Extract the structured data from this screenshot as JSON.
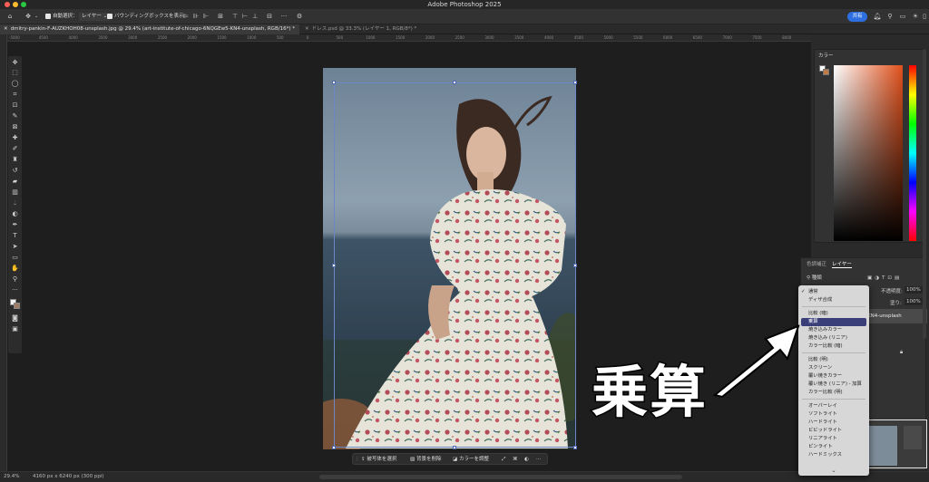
{
  "window": {
    "title": "Adobe Photoshop 2025"
  },
  "options_bar": {
    "auto_select_label": "自動選択：",
    "auto_select_value": "レイヤー",
    "bounding_box_label": "バウンディングボックスを表示",
    "share_label": "共有"
  },
  "tabs": [
    {
      "label": "dmitry-pankin-F-AUZKHOH08-unsplash.jpg @ 29.4% (art-institute-of-chicago-6NQGEw5-KN4-unsplash, RGB/16*) *",
      "active": true
    },
    {
      "label": "ドレス.psd @ 33.3% (レイヤー 1, RGB/8*) *",
      "active": false
    }
  ],
  "ruler": {
    "ticks": [
      "-5000",
      "4500",
      "4000",
      "3500",
      "3000",
      "2500",
      "2000",
      "1500",
      "1000",
      "500",
      "0",
      "500",
      "1000",
      "1500",
      "2000",
      "2500",
      "3000",
      "3500",
      "4000",
      "4500",
      "5000",
      "5500",
      "6000",
      "6500",
      "7000",
      "7500",
      "8000",
      "8500",
      "9000",
      "9500",
      "10000"
    ]
  },
  "toolbar": {
    "more_label": "···"
  },
  "context_bar": {
    "select_subject": "被写体を選択",
    "remove_bg": "背景を削除",
    "color_adjust": "カラーを調整",
    "more": "···"
  },
  "status": {
    "zoom": "29.4%",
    "doc_info": "4160 px x 6240 px (300 ppi)"
  },
  "color_panel": {
    "title": "カラー"
  },
  "layers_panel": {
    "tab_adjust": "色調補正",
    "tab_layers": "レイヤー",
    "filter_label": "種類",
    "opacity_label": "不透明度:",
    "opacity_value": "100%",
    "fill_label": "塗り:",
    "fill_value": "100%",
    "layer_name": "KN4-unsplash"
  },
  "blend_menu": {
    "groups": [
      [
        "通常",
        "ディザ合成"
      ],
      [
        "比較 (暗)",
        "乗算",
        "焼き込みカラー",
        "焼き込み (リニア)",
        "カラー比較 (暗)"
      ],
      [
        "比較 (明)",
        "スクリーン",
        "覆い焼きカラー",
        "覆い焼き (リニア) - 加算",
        "カラー比較 (明)"
      ],
      [
        "オーバーレイ",
        "ソフトライト",
        "ハードライト",
        "ビビッドライト",
        "リニアライト",
        "ピンライト",
        "ハードミックス"
      ]
    ],
    "selected": "乗算",
    "checked": "通常"
  },
  "annotation": {
    "text": "乗算"
  },
  "colors": {
    "accent": "#2d6fe0",
    "menu_selected": "#3a3f79",
    "selection_box": "#6c86c6"
  }
}
